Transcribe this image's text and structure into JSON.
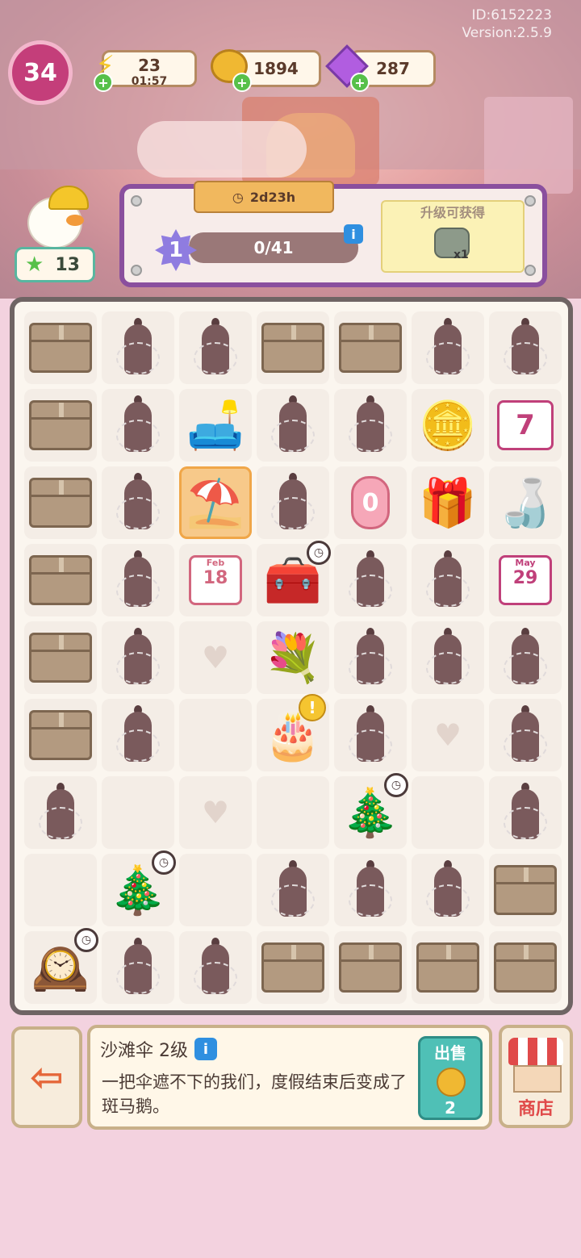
{
  "meta": {
    "id": "ID:6152223",
    "version": "Version:2.5.9"
  },
  "player": {
    "level": "34",
    "stars": "13"
  },
  "resources": {
    "energy": "23",
    "energy_timer": "01:57",
    "coins": "1894",
    "gems": "287"
  },
  "quest": {
    "timer": "2d23h",
    "level": "1",
    "progress": "0/41",
    "progress_fraction": 0,
    "reward_title": "升级可获得",
    "reward_count": "x1"
  },
  "board": {
    "rows": [
      [
        "box",
        "cone",
        "cone",
        "box",
        "box",
        "cone",
        "cone"
      ],
      [
        "box",
        "cone",
        "sofa",
        "cone",
        "cone",
        "coins",
        "calendar-7"
      ],
      [
        "box",
        "cone",
        "umbrella",
        "cone",
        "candle-0",
        "gift",
        "bottle"
      ],
      [
        "box",
        "cone",
        "calendar-feb-18",
        "match-box",
        "cone",
        "cone",
        "calendar-may-29"
      ],
      [
        "box",
        "cone",
        "heart",
        "bouquet",
        "cone",
        "cone",
        "cone"
      ],
      [
        "box",
        "cone",
        "empty",
        "cake",
        "cone",
        "heart",
        "cone"
      ],
      [
        "cone",
        "empty",
        "heart",
        "empty",
        "tree",
        "empty",
        "cone"
      ],
      [
        "empty",
        "tree",
        "empty",
        "cone",
        "cone",
        "cone",
        "box"
      ],
      [
        "clock-machine",
        "cone",
        "cone",
        "box",
        "box",
        "box",
        "box"
      ]
    ],
    "calendar_feb": "Feb",
    "calendar_feb_day": "18",
    "calendar_may": "May",
    "calendar_may_day": "29",
    "calendar_7": "7",
    "candle_0": "0"
  },
  "selected": {
    "name": "沙滩伞 2级",
    "description": "一把伞遮不下的我们，度假结束后变成了斑马鹅。",
    "sell_label": "出售",
    "sell_value": "2"
  },
  "shop": {
    "label": "商店"
  },
  "colors": {
    "accent": "#8a4f9e",
    "board_bg": "#fbf6ef",
    "sell": "#4fc0b6"
  }
}
